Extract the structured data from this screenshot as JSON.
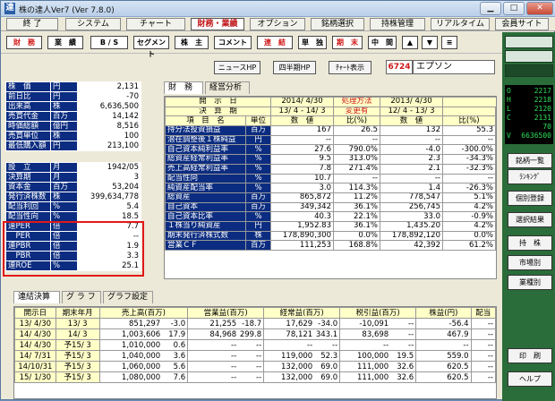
{
  "window": {
    "title": "株の達人Ver7 (Ver 7.8.0)",
    "icon_label": "達"
  },
  "menu": [
    {
      "label": "終 了"
    },
    {
      "label": "システム"
    },
    {
      "label": "チャート"
    },
    {
      "label": "財務・業績",
      "active": true
    },
    {
      "label": "オプション"
    },
    {
      "label": "銘柄選択"
    },
    {
      "label": "持株管理"
    },
    {
      "label": "リアルタイム"
    },
    {
      "label": "会員サイト"
    }
  ],
  "toolbar": [
    {
      "label": "財　務",
      "red": true
    },
    {
      "label": "業　績"
    },
    {
      "label": "B / S"
    },
    {
      "label": "セグメント"
    },
    {
      "label": "株　主"
    },
    {
      "label": "コメント"
    },
    {
      "label": "連　結",
      "red": true
    },
    {
      "label": "単　独"
    },
    {
      "label": "期　末",
      "red": true
    },
    {
      "label": "中　間"
    },
    {
      "label": "▲"
    },
    {
      "label": "▼"
    },
    {
      "label": "≡"
    }
  ],
  "links": {
    "news": "ニュースHP",
    "shikiho": "四半期HP",
    "chart": "ﾁｬｰﾄ表示"
  },
  "stock": {
    "code": "6724",
    "name": "エプソン"
  },
  "left_top": [
    {
      "k": "株　価",
      "u": "円",
      "v": "2,131"
    },
    {
      "k": "前日比",
      "u": "円",
      "v": "-70"
    },
    {
      "k": "出来高",
      "u": "株",
      "v": "6,636,500"
    },
    {
      "k": "売買代金",
      "u": "百万",
      "v": "14,142"
    },
    {
      "k": "時価総額",
      "u": "億円",
      "v": "8,516"
    },
    {
      "k": "売買単位",
      "u": "株",
      "v": "100"
    },
    {
      "k": "最低購入額",
      "u": "円",
      "v": "213,100"
    }
  ],
  "left_bottom": [
    {
      "k": "設　立",
      "u": "月",
      "v": "1942/05"
    },
    {
      "k": "決算期",
      "u": "月",
      "v": "3"
    },
    {
      "k": "資本金",
      "u": "百万",
      "v": "53,204"
    },
    {
      "k": "発行済株数",
      "u": "株",
      "v": "399,634,778"
    },
    {
      "k": "配当利回",
      "u": "%",
      "v": "5.4"
    },
    {
      "k": "配当性向",
      "u": "%",
      "v": "18.5"
    },
    {
      "k": "連PER",
      "u": "倍",
      "v": "7.7"
    },
    {
      "k": "　PER",
      "u": "倍",
      "v": "--"
    },
    {
      "k": "連PBR",
      "u": "倍",
      "v": "1.9"
    },
    {
      "k": "　PBR",
      "u": "倍",
      "v": "3.3"
    },
    {
      "k": "連ROE",
      "u": "%",
      "v": "25.1"
    }
  ],
  "tabs_top": [
    {
      "label": "財　務",
      "selected": true
    },
    {
      "label": "経営分析"
    }
  ],
  "fin_header": {
    "c1": "開　示　日",
    "d1": "2014/ 4/30",
    "m1": "処理方法",
    "d2": "2013/ 4/30",
    "c2": "決　算　期",
    "p1": "13/ 4 - 14/ 3",
    "m2": "変更有",
    "p2": "12/ 4 - 13/ 3",
    "c3": "項　目　名",
    "u": "単位",
    "n1": "数　値",
    "r1": "比(%)",
    "n2": "数　値",
    "r2": "比(%)"
  },
  "fin_rows": [
    {
      "l": "持分法投資損益",
      "u": "百万",
      "a": "167",
      "b": "26.5",
      "c": "132",
      "d": "55.3"
    },
    {
      "l": "潜在調整後１株純益",
      "u": "円",
      "a": "--",
      "b": "--",
      "c": "--",
      "d": "--"
    },
    {
      "l": "自己資本純利益率",
      "u": "%",
      "a": "27.6",
      "b": "790.0%",
      "c": "-4.0",
      "d": "-300.0%"
    },
    {
      "l": "総資産経常利益率",
      "u": "%",
      "a": "9.5",
      "b": "313.0%",
      "c": "2.3",
      "d": "-34.3%"
    },
    {
      "l": "売上高経常利益率",
      "u": "%",
      "a": "7.8",
      "b": "271.4%",
      "c": "2.1",
      "d": "-32.3%"
    },
    {
      "l": "配当性向",
      "u": "%",
      "a": "10.7",
      "b": "--",
      "c": "--",
      "d": "--"
    },
    {
      "l": "純資産配当率",
      "u": "%",
      "a": "3.0",
      "b": "114.3%",
      "c": "1.4",
      "d": "-26.3%"
    },
    {
      "l": "総資産",
      "u": "百万",
      "a": "865,872",
      "b": "11.2%",
      "c": "778,547",
      "d": "5.1%"
    },
    {
      "l": "自己資本",
      "u": "百万",
      "a": "349,342",
      "b": "36.1%",
      "c": "256,745",
      "d": "4.2%"
    },
    {
      "l": "自己資本比率",
      "u": "%",
      "a": "40.3",
      "b": "22.1%",
      "c": "33.0",
      "d": "-0.9%"
    },
    {
      "l": "１株当り純資産",
      "u": "円",
      "a": "1,952.83",
      "b": "36.1%",
      "c": "1,435.20",
      "d": "4.2%"
    },
    {
      "l": "期末発行済株式数",
      "u": "株",
      "a": "178,890,300",
      "b": "0.0%",
      "c": "178,892,120",
      "d": "0.0%"
    },
    {
      "l": "営業ＣＦ",
      "u": "百万",
      "a": "111,253",
      "b": "168.8%",
      "c": "42,392",
      "d": "61.2%"
    }
  ],
  "sidebar": {
    "quote": [
      {
        "l": "O",
        "v": "2217"
      },
      {
        "l": "H",
        "v": "2218"
      },
      {
        "l": "L",
        "v": "2120"
      },
      {
        "l": "C",
        "v": "2131"
      },
      {
        "l": "",
        "v": "70"
      },
      {
        "l": "V",
        "v": "6636500"
      }
    ],
    "buttons": [
      "銘柄一覧",
      "ﾗﾝｷﾝｸﾞ",
      "個別登録",
      "選択結果",
      "持　株",
      "市場別",
      "業種別",
      "印　刷",
      "ヘルプ"
    ]
  },
  "tabs_bottom": [
    {
      "label": "連結決算",
      "selected": true
    },
    {
      "label": "グ ラ フ"
    },
    {
      "label": "グラフ設定"
    }
  ],
  "bottom_header": [
    "開示日",
    "期末年月",
    "売上高(百万)",
    "営業益(百万)",
    "経常益(百万)",
    "税引益(百万)",
    "株益(円)",
    "配当"
  ],
  "bottom_rows": [
    {
      "d": "13/ 4/30",
      "p": "13/ 3",
      "s": "851,297",
      "sr": "-3.0",
      "o": "21,255",
      "or": "-18.7",
      "k": "17,629",
      "kr": "-34.0",
      "t": "-10,091",
      "tr": "--",
      "e": "-56.4",
      "dv": "--"
    },
    {
      "d": "14/ 4/30",
      "p": "14/ 3",
      "s": "1,003,606",
      "sr": "17.9",
      "o": "84,968",
      "or": "299.8",
      "k": "78,121",
      "kr": "343.1",
      "t": "83,698",
      "tr": "--",
      "e": "467.9",
      "dv": "--"
    },
    {
      "d": "14/ 4/30",
      "p": "予15/ 3",
      "s": "1,010,000",
      "sr": "0.6",
      "o": "--",
      "or": "--",
      "k": "--",
      "kr": "--",
      "t": "--",
      "tr": "--",
      "e": "--",
      "dv": "--"
    },
    {
      "d": "14/ 7/31",
      "p": "予15/ 3",
      "s": "1,040,000",
      "sr": "3.6",
      "o": "--",
      "or": "--",
      "k": "119,000",
      "kr": "52.3",
      "t": "100,000",
      "tr": "19.5",
      "e": "559.0",
      "dv": "--"
    },
    {
      "d": "14/10/31",
      "p": "予15/ 3",
      "s": "1,060,000",
      "sr": "5.6",
      "o": "--",
      "or": "--",
      "k": "132,000",
      "kr": "69.0",
      "t": "111,000",
      "tr": "32.6",
      "e": "620.5",
      "dv": "--"
    },
    {
      "d": "15/ 1/30",
      "p": "予15/ 3",
      "s": "1,080,000",
      "sr": "7.6",
      "o": "--",
      "or": "--",
      "k": "132,000",
      "kr": "69.0",
      "t": "111,000",
      "tr": "32.6",
      "e": "620.5",
      "dv": "--"
    }
  ]
}
